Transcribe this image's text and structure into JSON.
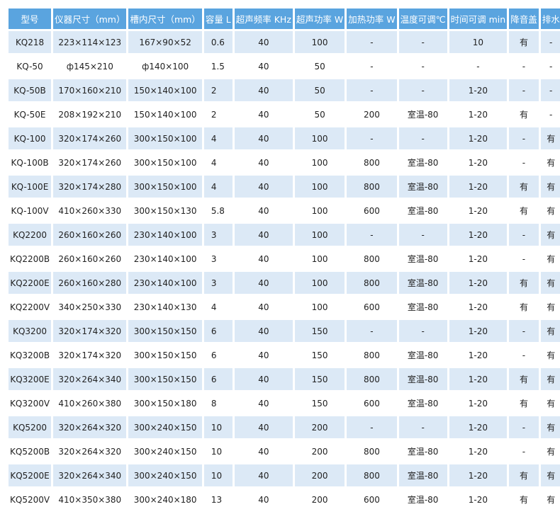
{
  "table": {
    "headers": [
      "型号",
      "仪器尺寸（mm）",
      "槽内尺寸（mm）",
      "容量 L",
      "超声频率 KHz",
      "超声功率 W",
      "加热功率 W",
      "温度可调℃",
      "时间可调 min",
      "降音盖",
      "排水"
    ],
    "rows": [
      [
        "KQ218",
        "223×114×123",
        "167×90×52",
        "0.6",
        "40",
        "100",
        "-",
        "-",
        "10",
        "有",
        "-"
      ],
      [
        "KQ-50",
        "ф145×210",
        "ф140×100",
        "1.5",
        "40",
        "50",
        "-",
        "-",
        "-",
        "-",
        "-"
      ],
      [
        "KQ-50B",
        "170×160×210",
        "150×140×100",
        "2",
        "40",
        "50",
        "-",
        "-",
        "1-20",
        "-",
        "-"
      ],
      [
        "KQ-50E",
        "208×192×210",
        "150×140×100",
        "2",
        "40",
        "50",
        "200",
        "室温-80",
        "1-20",
        "有",
        "-"
      ],
      [
        "KQ-100",
        "320×174×260",
        "300×150×100",
        "4",
        "40",
        "100",
        "-",
        "-",
        "1-20",
        "-",
        "有"
      ],
      [
        "KQ-100B",
        "320×174×260",
        "300×150×100",
        "4",
        "40",
        "100",
        "800",
        "室温-80",
        "1-20",
        "-",
        "有"
      ],
      [
        "KQ-100E",
        "320×174×280",
        "300×150×100",
        "4",
        "40",
        "100",
        "800",
        "室温-80",
        "1-20",
        "有",
        "有"
      ],
      [
        "KQ-100V",
        "410×260×330",
        "300×150×130",
        "5.8",
        "40",
        "100",
        "600",
        "室温-80",
        "1-20",
        "有",
        "有"
      ],
      [
        "KQ2200",
        "260×160×260",
        "230×140×100",
        "3",
        "40",
        "100",
        "-",
        "-",
        "1-20",
        "-",
        "有"
      ],
      [
        "KQ2200B",
        "260×160×260",
        "230×140×100",
        "3",
        "40",
        "100",
        "800",
        "室温-80",
        "1-20",
        "-",
        "有"
      ],
      [
        "KQ2200E",
        "260×160×280",
        "230×140×100",
        "3",
        "40",
        "100",
        "800",
        "室温-80",
        "1-20",
        "有",
        "有"
      ],
      [
        "KQ2200V",
        "340×250×330",
        "230×140×130",
        "4",
        "40",
        "100",
        "600",
        "室温-80",
        "1-20",
        "有",
        "有"
      ],
      [
        "KQ3200",
        "320×174×320",
        "300×150×150",
        "6",
        "40",
        "150",
        "-",
        "-",
        "1-20",
        "-",
        "有"
      ],
      [
        "KQ3200B",
        "320×174×320",
        "300×150×150",
        "6",
        "40",
        "150",
        "800",
        "室温-80",
        "1-20",
        "-",
        "有"
      ],
      [
        "KQ3200E",
        "320×264×340",
        "300×150×150",
        "6",
        "40",
        "150",
        "800",
        "室温-80",
        "1-20",
        "有",
        "有"
      ],
      [
        "KQ3200V",
        "410×260×380",
        "300×150×180",
        "8",
        "40",
        "150",
        "600",
        "室温-80",
        "1-20",
        "有",
        "有"
      ],
      [
        "KQ5200",
        "320×264×320",
        "300×240×150",
        "10",
        "40",
        "200",
        "-",
        "-",
        "1-20",
        "-",
        "有"
      ],
      [
        "KQ5200B",
        "320×264×320",
        "300×240×150",
        "10",
        "40",
        "200",
        "800",
        "室温-80",
        "1-20",
        "-",
        "有"
      ],
      [
        "KQ5200E",
        "320×264×340",
        "300×240×150",
        "10",
        "40",
        "200",
        "800",
        "室温-80",
        "1-20",
        "有",
        "有"
      ],
      [
        "KQ5200V",
        "410×350×380",
        "300×240×180",
        "13",
        "40",
        "200",
        "600",
        "室温-80",
        "1-20",
        "有",
        "有"
      ]
    ]
  },
  "colors": {
    "header_bg": "#5aa4df",
    "header_text": "#ffffff",
    "stripe_bg": "#dce9f6",
    "body_text": "#222222"
  }
}
